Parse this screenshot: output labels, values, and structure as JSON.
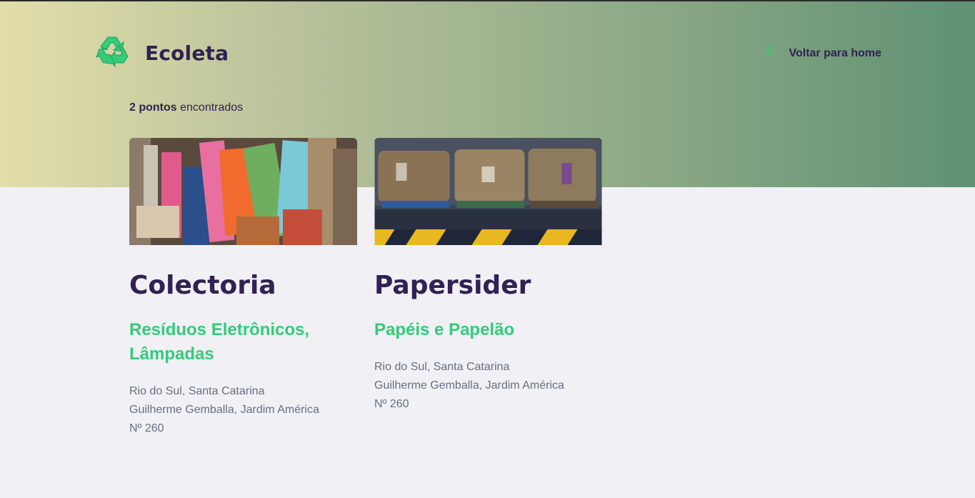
{
  "header": {
    "logo_text": "Ecoleta",
    "back_link_label": "Voltar para home"
  },
  "results": {
    "count_text": "2 pontos",
    "suffix_text": " encontrados"
  },
  "points": [
    {
      "name": "Colectoria",
      "items": "Resíduos Eletrônicos, Lâmpadas",
      "city_uf": "Rio do Sul, Santa Catarina",
      "street": "Guilherme Gemballa, Jardim América",
      "number": "Nº 260"
    },
    {
      "name": "Papersider",
      "items": "Papéis e Papelão",
      "city_uf": "Rio do Sul, Santa Catarina",
      "street": "Guilherme Gemballa, Jardim América",
      "number": "Nº 260"
    }
  ],
  "icons": {
    "logo": "recycle-icon",
    "back": "arrow-left-icon"
  },
  "colors": {
    "brand_dark": "#322153",
    "brand_green": "#34cb79",
    "text_gray": "#6c6c80",
    "background": "#f0f0f5"
  }
}
